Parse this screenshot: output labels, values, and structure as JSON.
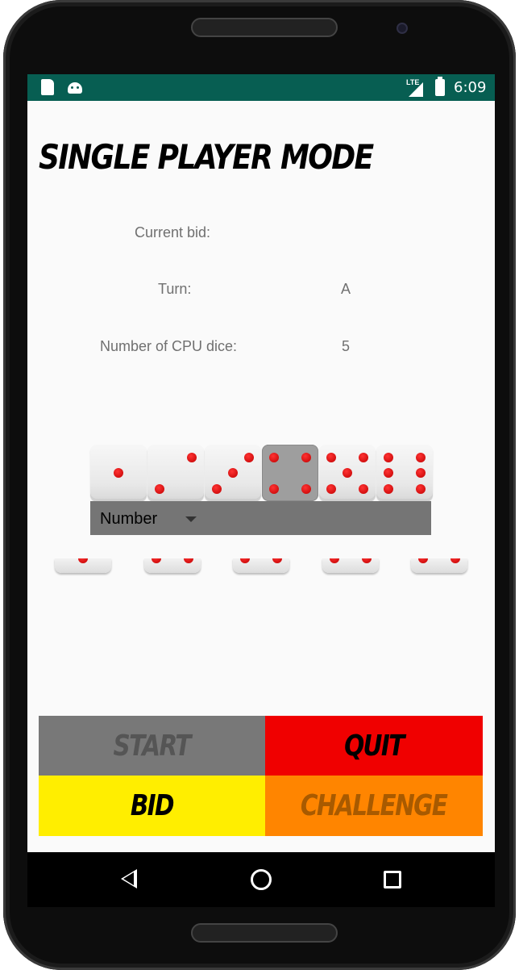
{
  "statusbar": {
    "network": "LTE",
    "time": "6:09"
  },
  "title": "Single Player Mode",
  "info": {
    "current_bid_label": "Current bid:",
    "current_bid_value": "",
    "turn_label": "Turn:",
    "turn_value": "A",
    "cpu_dice_label": "Number of CPU dice:",
    "cpu_dice_value": "5"
  },
  "face_selector": {
    "faces": [
      1,
      2,
      3,
      4,
      5,
      6
    ],
    "selected_face": 4
  },
  "spinner": {
    "label": "Number"
  },
  "cpu_dice": {
    "count": 5
  },
  "buttons": {
    "start": "START",
    "quit": "QUIT",
    "bid": "BID",
    "challenge": "CHALLENGE"
  },
  "colors": {
    "statusbar": "#075e52",
    "start_bg": "#787878",
    "quit_bg": "#f00000",
    "bid_bg": "#ffee00",
    "challenge_bg": "#ff8500",
    "pip": "#d00000"
  }
}
